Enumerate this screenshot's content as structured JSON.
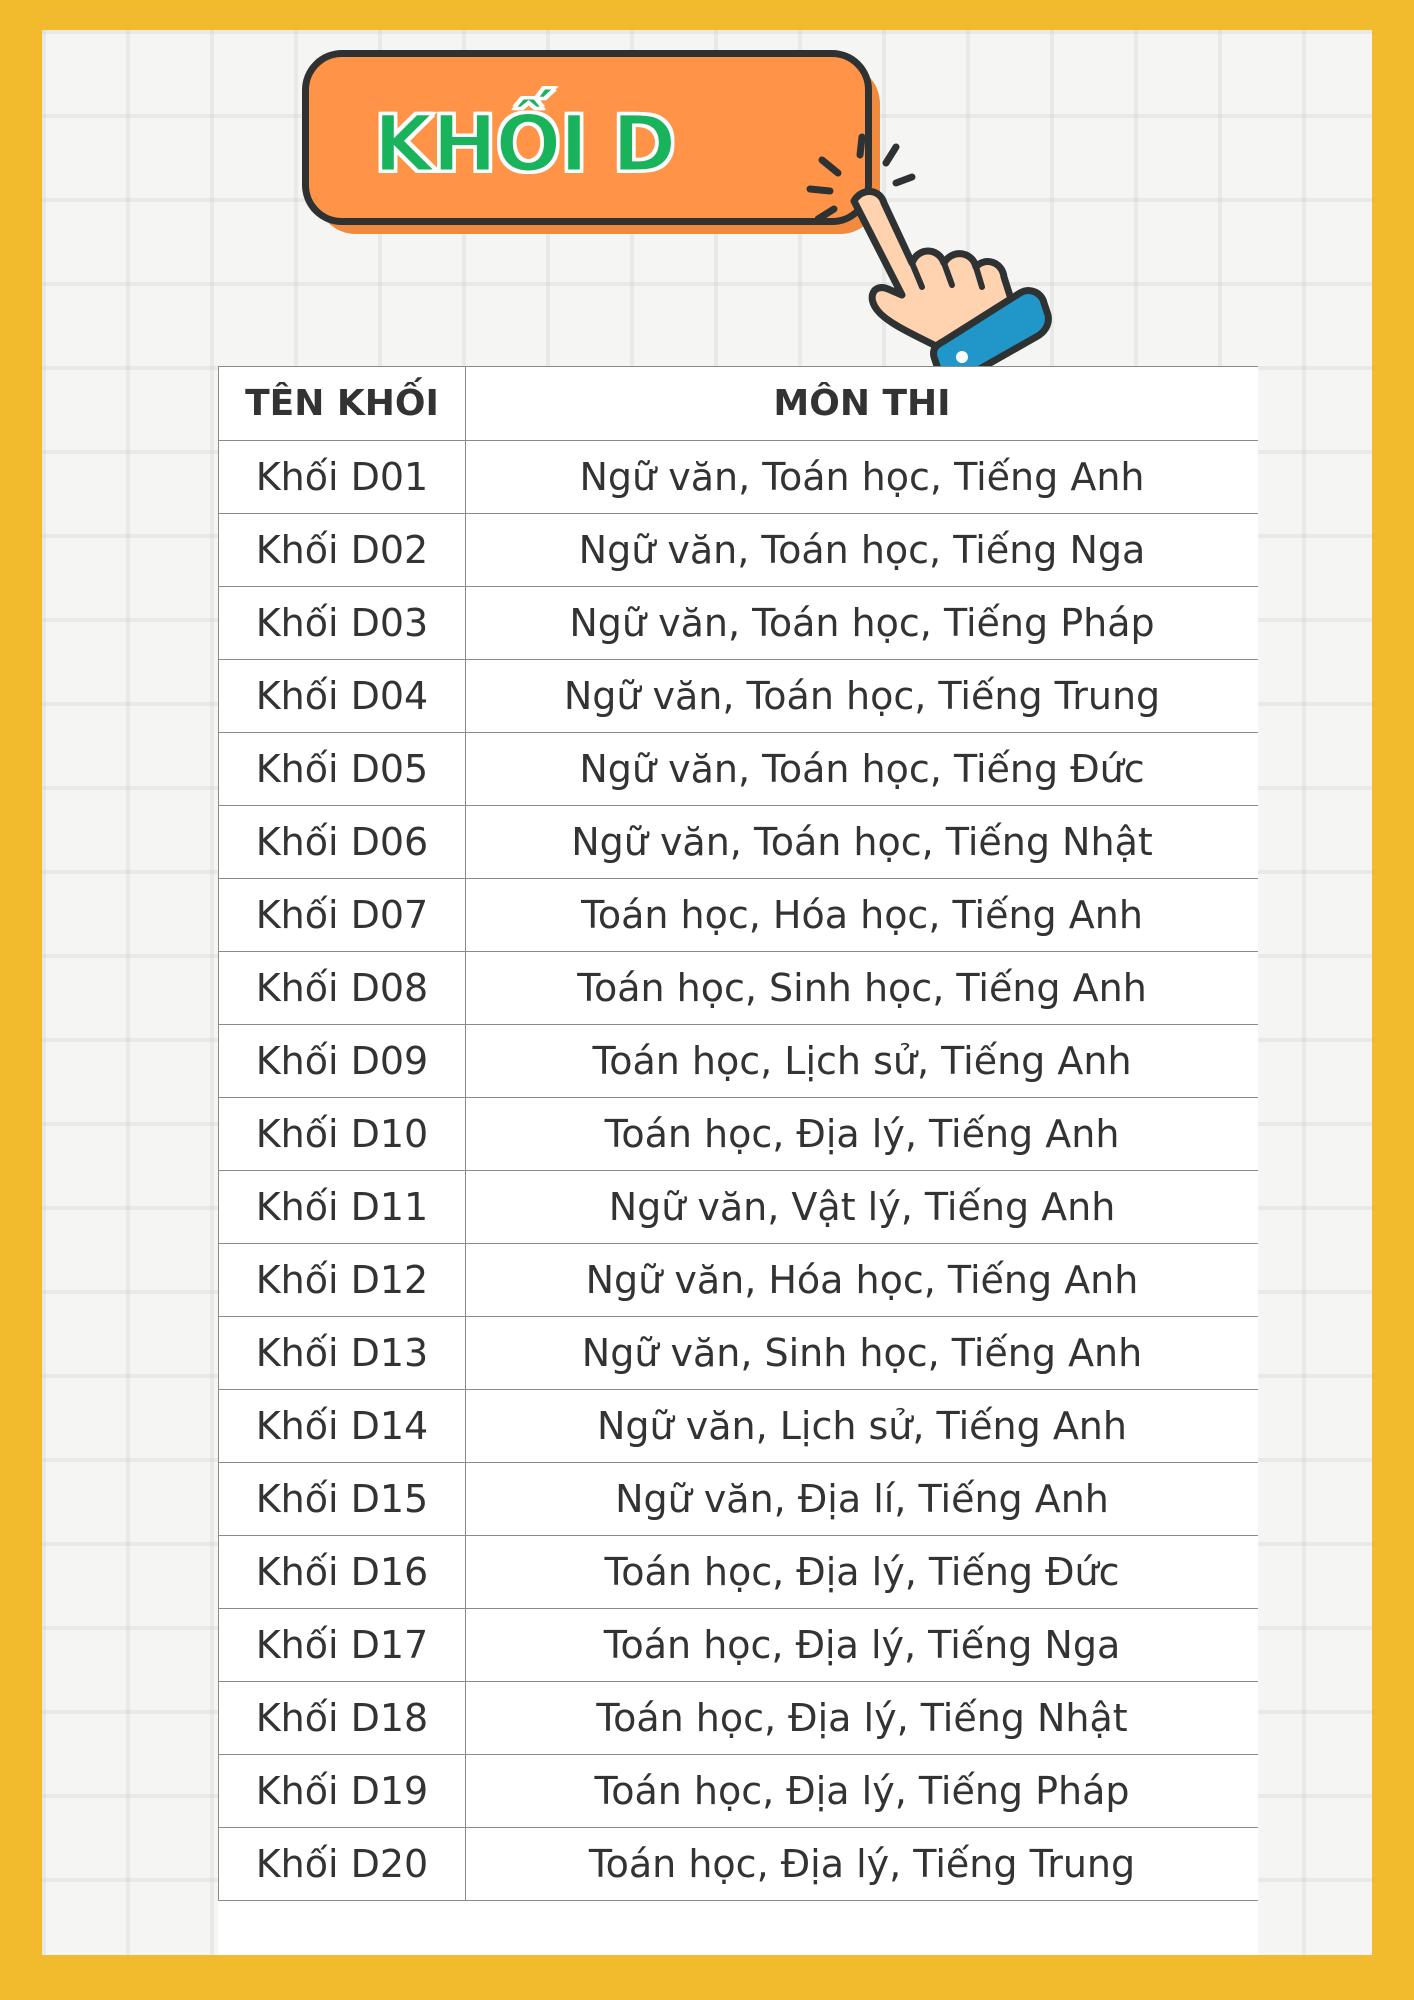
{
  "title": "KHỐI D",
  "colors": {
    "frame": "#F2BB2E",
    "button": "#FF9448",
    "title_text": "#19B35C",
    "cuff": "#2196C9",
    "skin": "#FFD2B0"
  },
  "icons": [
    "tap-hand-icon"
  ],
  "table": {
    "headers": [
      "TÊN KHỐI",
      "MÔN THI"
    ],
    "rows": [
      [
        "Khối D01",
        "Ngữ văn, Toán học, Tiếng Anh"
      ],
      [
        "Khối D02",
        "Ngữ văn, Toán học, Tiếng Nga"
      ],
      [
        "Khối D03",
        "Ngữ văn, Toán học, Tiếng Pháp"
      ],
      [
        "Khối D04",
        "Ngữ văn, Toán học, Tiếng Trung"
      ],
      [
        "Khối D05",
        "Ngữ văn, Toán học, Tiếng Đức"
      ],
      [
        "Khối D06",
        "Ngữ văn, Toán học, Tiếng Nhật"
      ],
      [
        "Khối D07",
        "Toán học, Hóa học, Tiếng Anh"
      ],
      [
        "Khối D08",
        "Toán học, Sinh học, Tiếng Anh"
      ],
      [
        "Khối D09",
        "Toán học, Lịch sử, Tiếng Anh"
      ],
      [
        "Khối D10",
        "Toán học, Địa lý, Tiếng Anh"
      ],
      [
        "Khối D11",
        "Ngữ văn, Vật lý, Tiếng Anh"
      ],
      [
        "Khối D12",
        "Ngữ văn, Hóa học, Tiếng Anh"
      ],
      [
        "Khối D13",
        "Ngữ văn, Sinh học, Tiếng Anh"
      ],
      [
        "Khối D14",
        "Ngữ văn, Lịch sử, Tiếng Anh"
      ],
      [
        "Khối D15",
        "Ngữ văn, Địa lí, Tiếng Anh"
      ],
      [
        "Khối D16",
        "Toán học, Địa lý, Tiếng Đức"
      ],
      [
        "Khối D17",
        "Toán học, Địa lý, Tiếng Nga"
      ],
      [
        "Khối D18",
        "Toán học, Địa lý, Tiếng Nhật"
      ],
      [
        "Khối D19",
        "Toán học, Địa lý, Tiếng Pháp"
      ],
      [
        "Khối D20",
        "Toán học, Địa lý, Tiếng Trung"
      ]
    ]
  }
}
